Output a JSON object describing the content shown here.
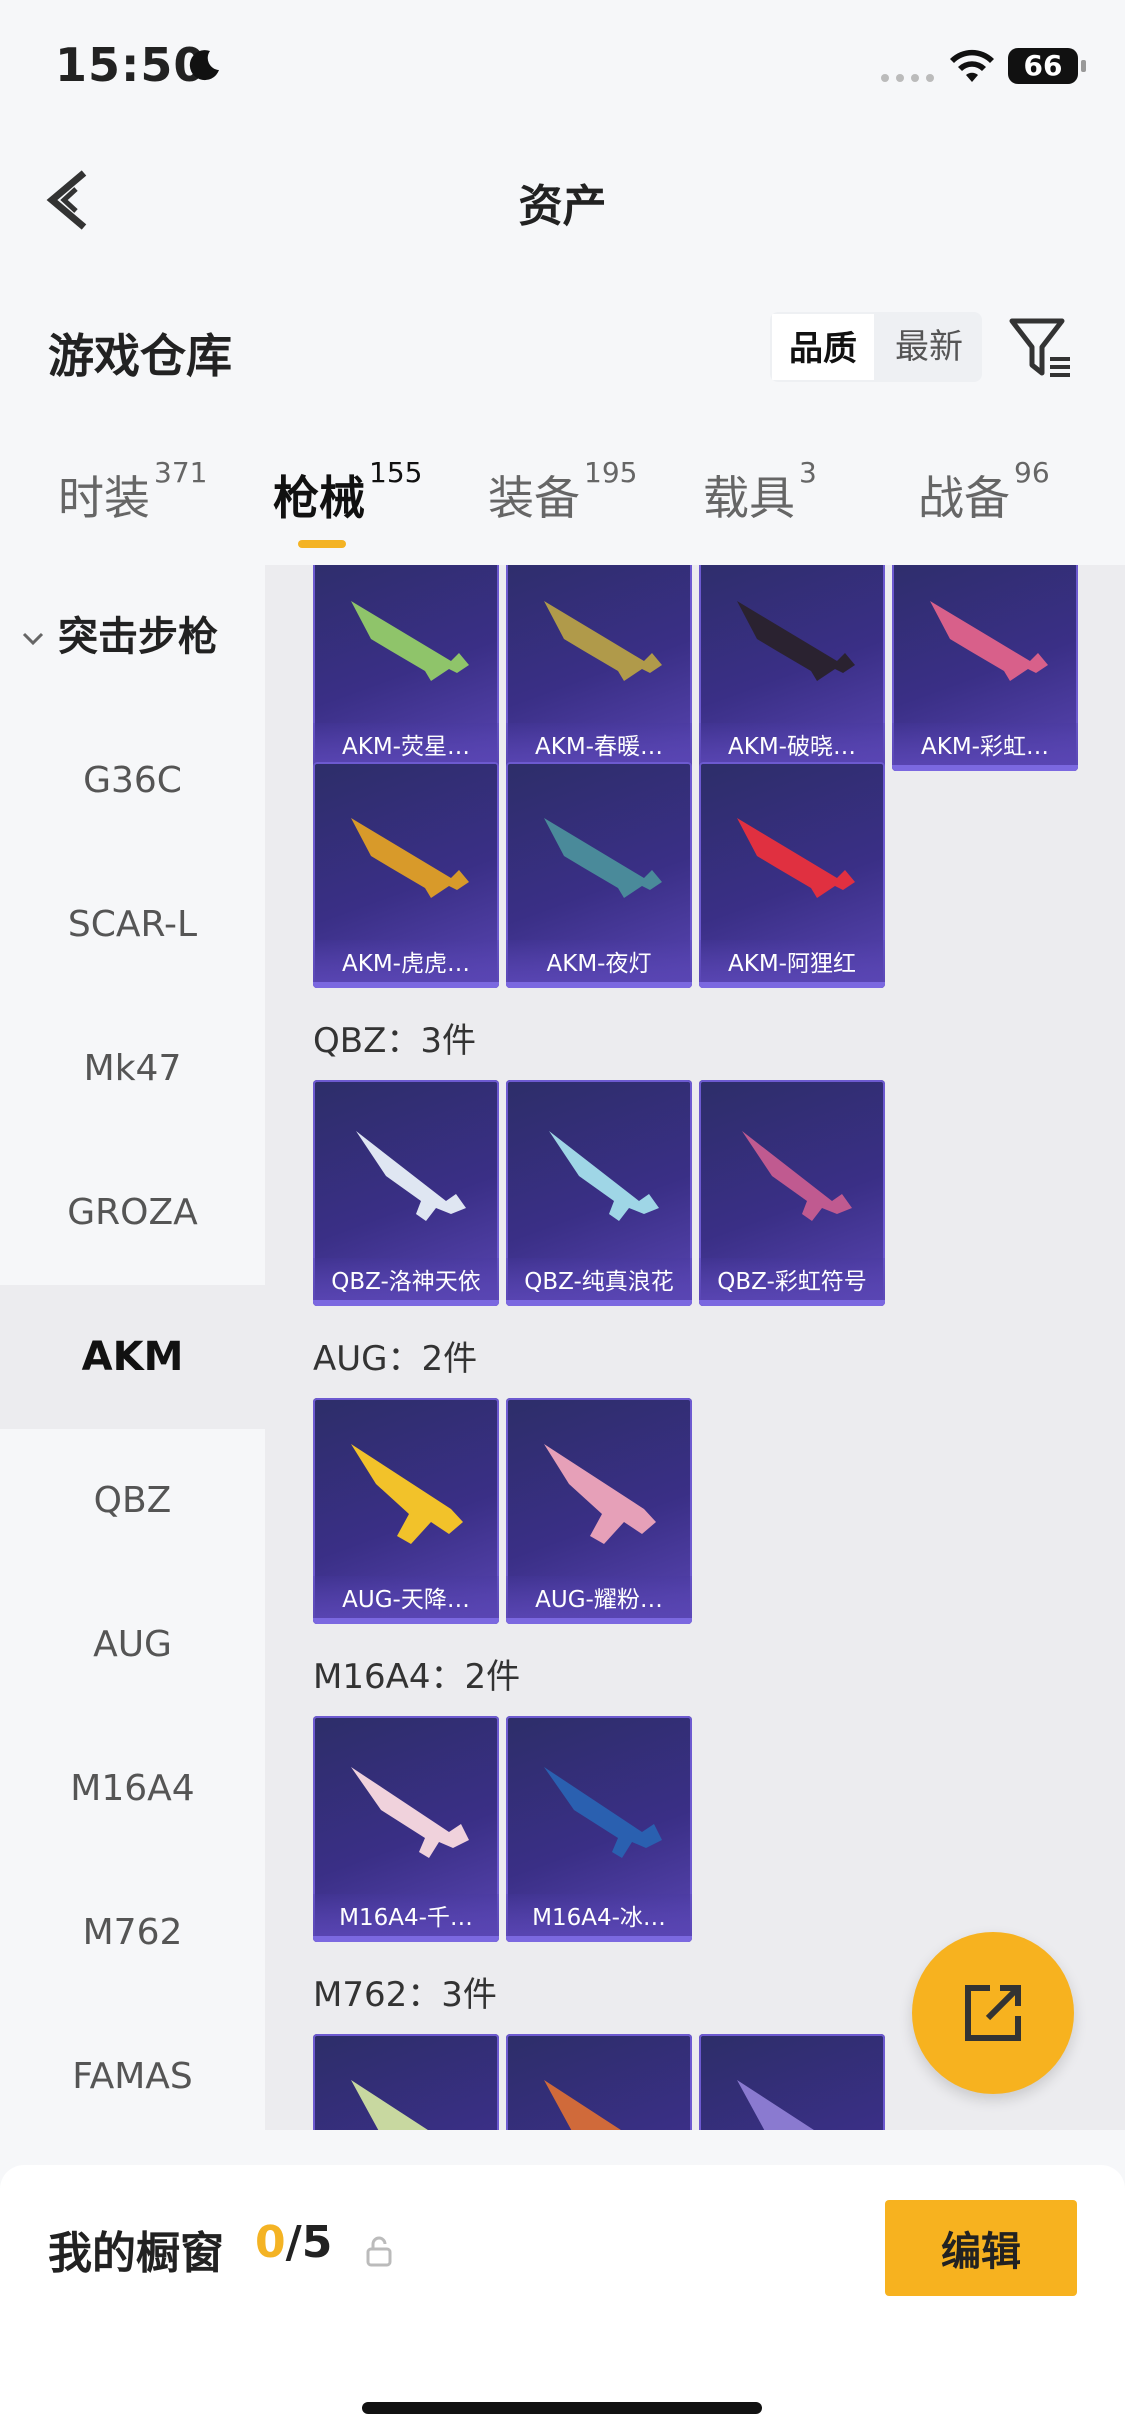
{
  "status_bar": {
    "time": "15:50",
    "battery": "66"
  },
  "header": {
    "title": "资产"
  },
  "section": {
    "title": "游戏仓库"
  },
  "sort": {
    "options": [
      "品质",
      "最新"
    ],
    "selected": "品质"
  },
  "tabs": [
    {
      "label": "时装",
      "count": "371"
    },
    {
      "label": "枪械",
      "count": "155",
      "active": true
    },
    {
      "label": "装备",
      "count": "195"
    },
    {
      "label": "载具",
      "count": "3"
    },
    {
      "label": "战备",
      "count": "96"
    }
  ],
  "sidebar": {
    "category": "突击步枪",
    "items": [
      "G36C",
      "SCAR-L",
      "Mk47",
      "GROZA",
      "AKM",
      "QBZ",
      "AUG",
      "M16A4",
      "M762",
      "FAMAS"
    ],
    "active": "AKM"
  },
  "groups": {
    "akm": {
      "items": [
        "AKM-荧星…",
        "AKM-春暖…",
        "AKM-破晓…",
        "AKM-彩虹…",
        "AKM-虎虎…",
        "AKM-夜灯",
        "AKM-阿狸红"
      ]
    },
    "qbz": {
      "title": "QBZ：3件",
      "items": [
        "QBZ-洛神天依",
        "QBZ-纯真浪花",
        "QBZ-彩虹符号"
      ]
    },
    "aug": {
      "title": "AUG：2件",
      "items": [
        "AUG-天降…",
        "AUG-耀粉…"
      ]
    },
    "m16a4": {
      "title": "M16A4：2件",
      "items": [
        "M16A4-千…",
        "M16A4-冰…"
      ]
    },
    "m762": {
      "title": "M762：3件"
    }
  },
  "bottom": {
    "showcase_label": "我的橱窗",
    "showcase_current": "0",
    "showcase_total": "/5",
    "edit_label": "编辑"
  },
  "colors": {
    "accent": "#f7b21f",
    "card_bg": "#3a2f86"
  }
}
